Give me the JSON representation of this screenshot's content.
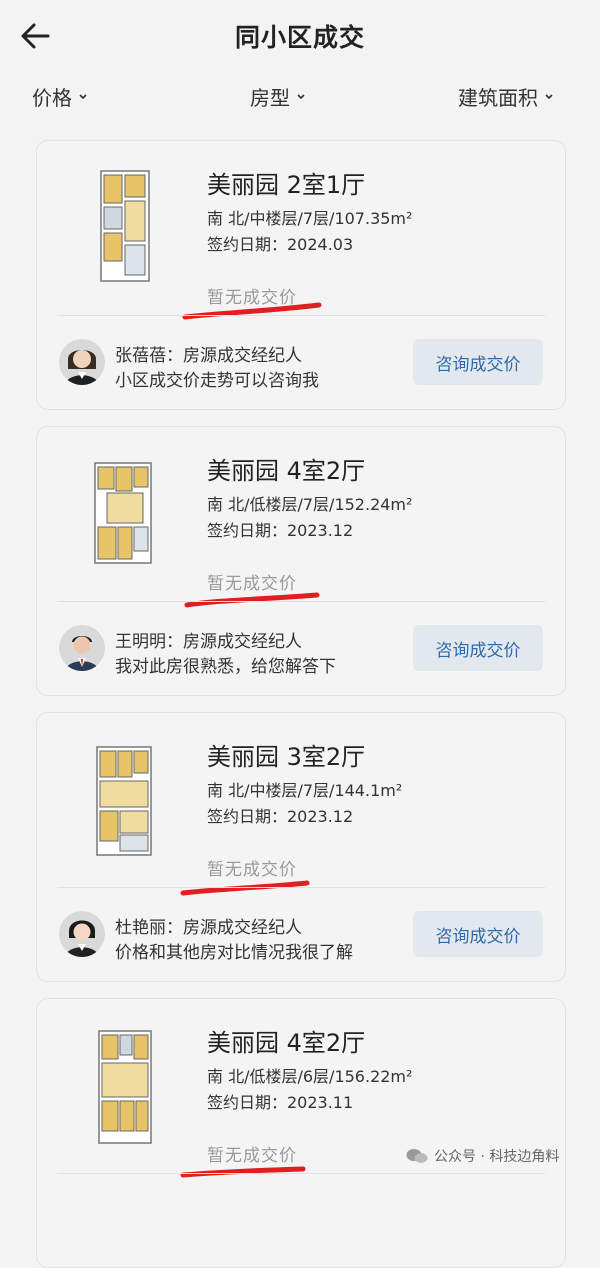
{
  "header": {
    "title": "同小区成交"
  },
  "filters": [
    {
      "label": "价格"
    },
    {
      "label": "房型"
    },
    {
      "label": "建筑面积"
    }
  ],
  "listings": [
    {
      "name": "美丽园 2室1厅",
      "spec": "南 北/中楼层/7层/107.35m²",
      "date": "签约日期：2024.03",
      "price": "暂无成交价",
      "agent": "张蓓蓓：房源成交经纪人",
      "message": "小区成交价走势可以咨询我",
      "button": "咨询成交价"
    },
    {
      "name": "美丽园 4室2厅",
      "spec": "南 北/低楼层/7层/152.24m²",
      "date": "签约日期：2023.12",
      "price": "暂无成交价",
      "agent": "王明明：房源成交经纪人",
      "message": "我对此房很熟悉，给您解答下",
      "button": "咨询成交价"
    },
    {
      "name": "美丽园 3室2厅",
      "spec": "南 北/中楼层/7层/144.1m²",
      "date": "签约日期：2023.12",
      "price": "暂无成交价",
      "agent": "杜艳丽：房源成交经纪人",
      "message": "价格和其他房对比情况我很了解",
      "button": "咨询成交价"
    },
    {
      "name": "美丽园 4室2厅",
      "spec": "南 北/低楼层/6层/156.22m²",
      "date": "签约日期：2023.11",
      "price": "暂无成交价"
    }
  ],
  "watermark": "公众号 · 科技边角料",
  "colors": {
    "accent": "#2f6aa8",
    "button_bg": "#e3e8ee",
    "annotation": "#e02020"
  }
}
